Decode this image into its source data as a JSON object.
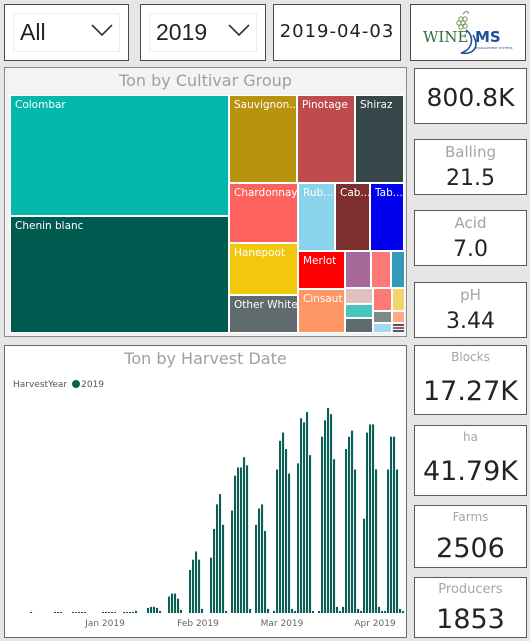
{
  "slicers": {
    "cultivar": {
      "value": "All"
    },
    "year": {
      "value": "2019"
    },
    "date": {
      "value": "2019-04-03"
    }
  },
  "logo": {
    "text_main": "WINE",
    "text_ms": "MS",
    "tagline": "MANAGEMENT SYSTEMS"
  },
  "treemap": {
    "title": "Ton by Cultivar Group",
    "items": [
      {
        "label": "Colombar",
        "color": "#01b8aa"
      },
      {
        "label": "Chenin blanc",
        "color": "#005a50"
      },
      {
        "label": "Sauvignon...",
        "color": "#b8930d"
      },
      {
        "label": "Pinotage",
        "color": "#c04b4c"
      },
      {
        "label": "Shiraz",
        "color": "#374649"
      },
      {
        "label": "Chardonnay",
        "color": "#fd625e"
      },
      {
        "label": "Rub...",
        "color": "#8ad4eb"
      },
      {
        "label": "Cab...",
        "color": "#7c2f2d"
      },
      {
        "label": "Tab...",
        "color": "#0000ee"
      },
      {
        "label": "Hanepoot",
        "color": "#f2c80f"
      },
      {
        "label": "Merlot",
        "color": "#fe0000"
      },
      {
        "label": "Other White",
        "color": "#5f6b6d"
      },
      {
        "label": "Cinsaut",
        "color": "#fe9666"
      },
      {
        "label": "",
        "color": "#a66999"
      },
      {
        "label": "",
        "color": "#fd7976"
      },
      {
        "label": "",
        "color": "#3599b8"
      },
      {
        "label": "",
        "color": "#dfbfbf"
      },
      {
        "label": "",
        "color": "#fd7976"
      },
      {
        "label": "",
        "color": "#f5d36b"
      },
      {
        "label": "",
        "color": "#4ac5bb"
      },
      {
        "label": "",
        "color": "#7f898a"
      },
      {
        "label": "",
        "color": "#fea888"
      },
      {
        "label": "",
        "color": "#5f6b6d"
      },
      {
        "label": "",
        "color": "#a5d9ee"
      }
    ]
  },
  "kpis": {
    "total_ton": {
      "label": "",
      "value": "800.8K"
    },
    "balling": {
      "label": "Balling",
      "value": "21.5"
    },
    "acid": {
      "label": "Acid",
      "value": "7.0"
    },
    "ph": {
      "label": "pH",
      "value": "3.44"
    },
    "blocks": {
      "label": "Blocks",
      "value": "17.27K"
    },
    "ha": {
      "label": "ha",
      "value": "41.79K"
    },
    "farms": {
      "label": "Farms",
      "value": "2506"
    },
    "producers": {
      "label": "Producers",
      "value": "1853"
    }
  },
  "chart_data": {
    "type": "bar",
    "title": "Ton by Harvest Date",
    "legend": {
      "title": "HarvestYear",
      "entries": [
        "2019"
      ],
      "placement": "top-left"
    },
    "series_color": "#0b5f55",
    "xlabel": "",
    "ylabel": "",
    "x_ticks": [
      "Jan 2019",
      "Feb 2019",
      "Mar 2019",
      "Apr 2019"
    ],
    "x_range": [
      "2018-12-06",
      "2019-04-03"
    ],
    "y_unit": "relative (% of max)",
    "ylim": [
      0,
      100
    ],
    "grid": false,
    "values": [
      0.5,
      0,
      0,
      0,
      0,
      0,
      0,
      0,
      0.5,
      0.5,
      0.5,
      0,
      0,
      0,
      0.5,
      0.5,
      0.5,
      0.5,
      0.5,
      0,
      0,
      0,
      0,
      0,
      0.5,
      0.5,
      0.5,
      0.5,
      0.5,
      0,
      0,
      0.5,
      0.5,
      0.5,
      0.5,
      1,
      0,
      0,
      0,
      2.5,
      3,
      3,
      2.5,
      1,
      0,
      0,
      8,
      9.5,
      9.5,
      7,
      1.5,
      0,
      0,
      21,
      26,
      30,
      26,
      2,
      0,
      0,
      27,
      41,
      53,
      58,
      43,
      1,
      0,
      50,
      67,
      71,
      71,
      76,
      72,
      2,
      0,
      43,
      51,
      53,
      40,
      2,
      0,
      1,
      70,
      84,
      88,
      80,
      68,
      2,
      1,
      73,
      95,
      93,
      98,
      77,
      1,
      0,
      1,
      86,
      94,
      100,
      97,
      75,
      3,
      1,
      3,
      80,
      86,
      89,
      70,
      2,
      1,
      46,
      88,
      92,
      92,
      70,
      3,
      1,
      1,
      70,
      86,
      86,
      70,
      2,
      1,
      0,
      2,
      64,
      74,
      62,
      48,
      5,
      2,
      0,
      1,
      82,
      74,
      2,
      1,
      1,
      0,
      46,
      63,
      48,
      26,
      2,
      0,
      0,
      58,
      73,
      67,
      55,
      6,
      0,
      0,
      43,
      50,
      50,
      36,
      6,
      0,
      0,
      32,
      52,
      44,
      38,
      1,
      0
    ]
  }
}
